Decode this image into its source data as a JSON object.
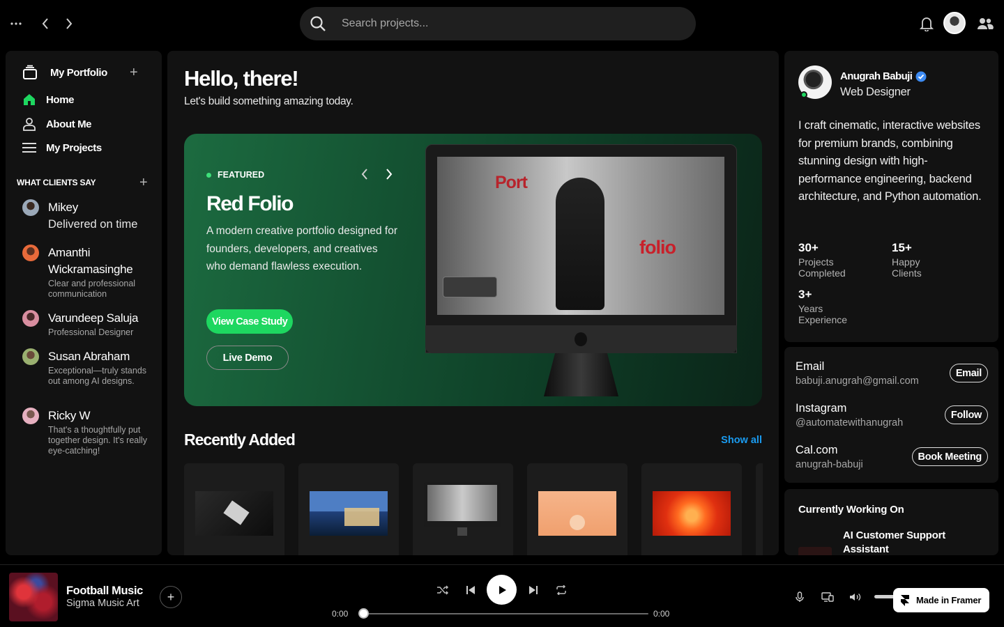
{
  "search": {
    "placeholder": "Search projects..."
  },
  "sidebar": {
    "library_title": "My Portfolio",
    "nav": [
      {
        "label": "Home",
        "icon": "home-icon"
      },
      {
        "label": "About Me",
        "icon": "user-icon"
      },
      {
        "label": "My Projects",
        "icon": "list-icon"
      }
    ],
    "reviews_title": "WHAT CLIENTS SAY",
    "reviews": [
      {
        "name": "Mikey",
        "text": "Delivered on time"
      },
      {
        "name": "Amanthi Wickramasinghe",
        "text": "Clear and professional communication"
      },
      {
        "name": "Varundeep Saluja",
        "text": "Professional Designer"
      },
      {
        "name": "Susan Abraham",
        "text": "Exceptional—truly stands out among AI designs."
      },
      {
        "name": "Ricky W",
        "text": "That's a thoughtfully put together design. It's really eye-catching!"
      }
    ]
  },
  "main": {
    "greeting": "Hello, there!",
    "subtitle": "Let's build something amazing today.",
    "featured": {
      "badge": "FEATURED",
      "title": "Red Folio",
      "description": "A modern creative portfolio designed for founders, developers, and creatives who demand flawless execution.",
      "primary_button": "View Case Study",
      "secondary_button": "Live Demo",
      "screen_text_1": "Port",
      "screen_text_2": "folio"
    },
    "recently_added": {
      "title": "Recently Added",
      "show_all": "Show all"
    }
  },
  "profile": {
    "name": "Anugrah Babuji",
    "role": "Web Designer",
    "bio": "I craft cinematic, interactive websites for premium brands, combining stunning design with high-performance engineering, backend architecture, and Python automation.",
    "stats": [
      {
        "value": "30+",
        "label": "Projects Completed"
      },
      {
        "value": "15+",
        "label": "Happy Clients"
      },
      {
        "value": "3+",
        "label": "Years Experience"
      }
    ]
  },
  "contacts": [
    {
      "title": "Email",
      "detail": "babuji.anugrah@gmail.com",
      "button": "Email"
    },
    {
      "title": "Instagram",
      "detail": "@automatewithanugrah",
      "button": "Follow"
    },
    {
      "title": "Cal.com",
      "detail": "anugrah-babuji",
      "button": "Book Meeting"
    }
  ],
  "working_on": {
    "title": "Currently Working On",
    "project": "AI Customer Support Assistant"
  },
  "player": {
    "song": "Football Music",
    "artist": "Sigma Music Art",
    "elapsed": "0:00",
    "duration": "0:00",
    "badge": "Made in Framer"
  },
  "colors": {
    "accent": "#1ed760",
    "link": "#1a9bf0",
    "panel": "#121212"
  }
}
